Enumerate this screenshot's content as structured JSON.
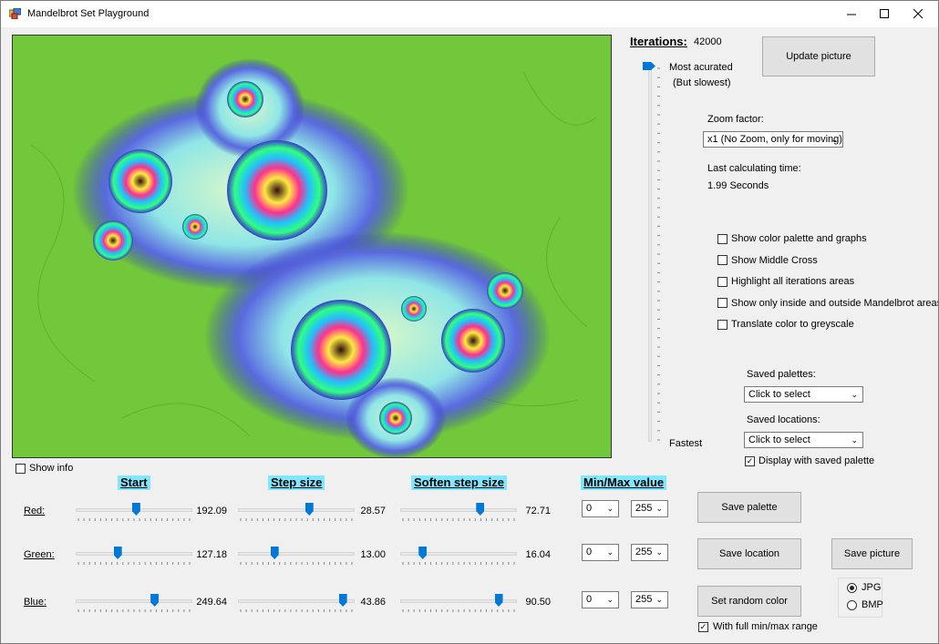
{
  "window": {
    "title": "Mandelbrot Set Playground",
    "minimize_icon": "minimize-icon",
    "maximize_icon": "maximize-icon",
    "close_icon": "close-icon"
  },
  "iterations": {
    "label": "Iterations:",
    "value": "42000",
    "most_accurate": "Most acurated",
    "but_slowest": "(But slowest)",
    "fastest": "Fastest"
  },
  "update_button": "Update picture",
  "zoom": {
    "label": "Zoom factor:",
    "selected": "x1 (No Zoom, only for moving)"
  },
  "calc_time": {
    "label": "Last calculating time:",
    "value": "1.99 Seconds"
  },
  "options": [
    {
      "label": "Show color palette and graphs",
      "checked": false
    },
    {
      "label": "Show Middle Cross",
      "checked": false
    },
    {
      "label": "Highlight all iterations areas",
      "checked": false
    },
    {
      "label": "Show only inside and outside Mandelbrot areas",
      "checked": false
    },
    {
      "label": "Translate color to greyscale",
      "checked": false
    }
  ],
  "saved_palettes": {
    "label": "Saved palettes:",
    "selected": "Click to select"
  },
  "saved_locations": {
    "label": "Saved locations:",
    "selected": "Click to select"
  },
  "display_saved_palette": {
    "label": "Display with saved palette",
    "checked": true
  },
  "show_info": {
    "label": "Show info",
    "checked": false
  },
  "headers": {
    "start": "Start",
    "step": "Step size",
    "soften": "Soften step size",
    "minmax": "Min/Max value"
  },
  "channels": [
    {
      "name": "Red:",
      "start": "192.09",
      "step": "28.57",
      "soften": "72.71",
      "min": "0",
      "max": "255",
      "start_frac": 0.52,
      "step_frac": 0.62,
      "soften_frac": 0.7
    },
    {
      "name": "Green:",
      "start": "127.18",
      "step": "13.00",
      "soften": "16.04",
      "min": "0",
      "max": "255",
      "start_frac": 0.35,
      "step_frac": 0.3,
      "soften_frac": 0.17
    },
    {
      "name": "Blue:",
      "start": "249.64",
      "step": "43.86",
      "soften": "90.50",
      "min": "0",
      "max": "255",
      "start_frac": 0.69,
      "step_frac": 0.93,
      "soften_frac": 0.87
    }
  ],
  "buttons": {
    "save_palette": "Save  palette",
    "save_location": "Save location",
    "save_picture": "Save picture",
    "random_color": "Set random color"
  },
  "full_range": {
    "label": "With full min/max range",
    "checked": true
  },
  "format": {
    "options": [
      "JPG",
      "BMP"
    ],
    "selected": "JPG"
  },
  "colors": {
    "slider_thumb": "#0078d7",
    "header_highlight": "#7fe8ff",
    "fractal_background": "#71c83a"
  }
}
